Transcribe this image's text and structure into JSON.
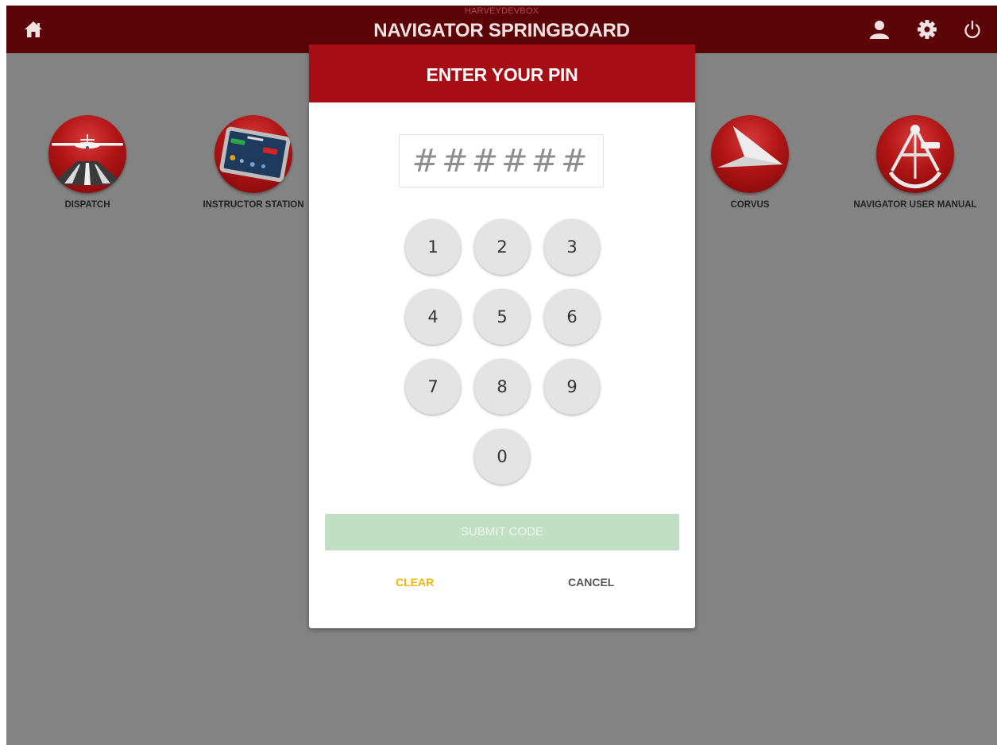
{
  "header": {
    "hostname": "HARVEYDEVBOX",
    "title": "NAVIGATOR SPRINGBOARD",
    "icons": [
      "home-icon",
      "user-icon",
      "gear-icon",
      "power-icon"
    ]
  },
  "apps": [
    {
      "label": "DISPATCH",
      "icon": "airplane-runway-icon"
    },
    {
      "label": "INSTRUCTOR STATION",
      "icon": "tablet-icon"
    },
    {
      "label": "CORVUS",
      "icon": "corvus-arrow-icon"
    },
    {
      "label": "NAVIGATOR USER MANUAL",
      "icon": "sextant-icon"
    }
  ],
  "pin_dialog": {
    "title": "ENTER YOUR PIN",
    "pin_placeholder": "######",
    "keys": [
      "1",
      "2",
      "3",
      "4",
      "5",
      "6",
      "7",
      "8",
      "9",
      "0"
    ],
    "submit_label": "SUBMIT CODE",
    "clear_label": "CLEAR",
    "cancel_label": "CANCEL"
  },
  "colors": {
    "header_bg": "#5c0509",
    "dialog_header": "#a60d14",
    "submit_disabled": "#c1dfc2",
    "clear": "#f2b705",
    "background": "#838383"
  }
}
